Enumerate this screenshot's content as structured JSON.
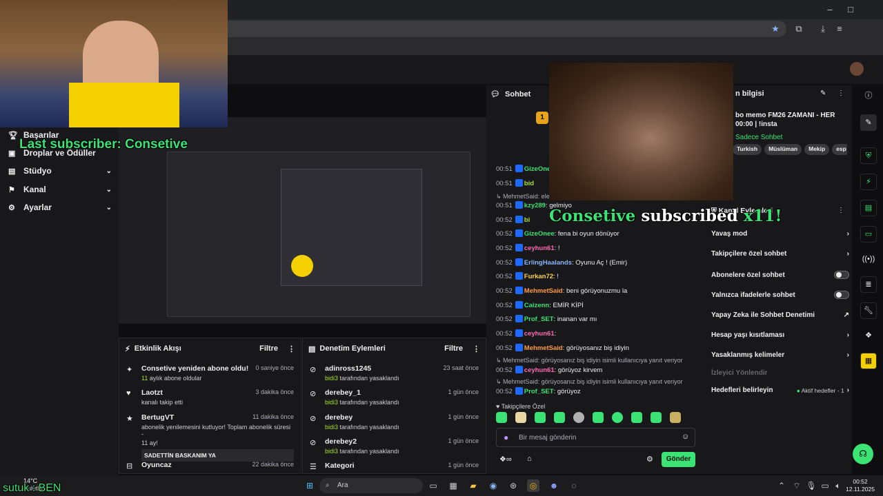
{
  "overlay": {
    "last_subscriber": "Last subscriber: Consetive",
    "sub_alert_name": "Consetive",
    "sub_alert_text": "subscribed",
    "sub_alert_count": "x11!",
    "stream_tag": "sutuk : BEN"
  },
  "leftnav": {
    "items": [
      {
        "label": "Başarılar",
        "icon": "trophy-icon"
      },
      {
        "label": "Droplar ve Ödüller",
        "icon": "gift-icon"
      },
      {
        "label": "Stüdyo",
        "icon": "studio-icon"
      },
      {
        "label": "Kanal",
        "icon": "channel-icon"
      },
      {
        "label": "Ayarlar",
        "icon": "gear-icon"
      }
    ]
  },
  "activity": {
    "title": "Etkinlik Akışı",
    "filter": "Filtre",
    "items": [
      {
        "who": "Consetive yeniden abone oldu!",
        "sub_num": "11",
        "sub": " aylık abone oldular",
        "time": "0 saniye önce"
      },
      {
        "who": "Laotzt",
        "sub": "kanalı takip etti",
        "time": "3 dakika önce"
      },
      {
        "who": "BertugVT",
        "sub": "abonelik yenilemesini kutluyor! Toplam abonelik süresi -",
        "sub2": "11 ay!",
        "time": "11 dakika önce",
        "message": "SADETTİN BASKANIM YA"
      },
      {
        "who": "Oyuncaz",
        "time": "22 dakika önce"
      }
    ]
  },
  "moderation": {
    "title": "Denetim Eylemleri",
    "filter": "Filtre",
    "items": [
      {
        "who": "adinross1245",
        "by": "bidi3",
        "sub": " tarafından yasaklandı",
        "time": "23 saat önce"
      },
      {
        "who": "derebey_1",
        "by": "bidi3",
        "sub": " tarafından yasaklandı",
        "time": "1 gün önce"
      },
      {
        "who": "derebey",
        "by": "bidi3",
        "sub": " tarafından yasaklandı",
        "time": "1 gün önce"
      },
      {
        "who": "derebey2",
        "by": "bidi3",
        "sub": " tarafından yasaklandı",
        "time": "1 gün önce"
      },
      {
        "who": "Kategori",
        "time": "1 gün önce"
      }
    ]
  },
  "chat": {
    "title": "Sohbet",
    "lines": [
      {
        "ts": "00:51",
        "user": "GizeOnee",
        "color": "#3ae374",
        "msg": ""
      },
      {
        "ts": "00:51",
        "user": "bid",
        "color": "#a6e22e",
        "msg": ""
      },
      {
        "reply": "MehmetSaid: elek"
      },
      {
        "ts": "00:51",
        "user": "kzy289",
        "color": "#3ae374",
        "msg": ": gelmiyo"
      },
      {
        "ts": "00:52",
        "user": "bi",
        "color": "#a6e22e",
        "msg": ""
      },
      {
        "ts": "00:52",
        "user": "GizeOnee",
        "color": "#3ae374",
        "msg": ": fena bi oyun dönüyor"
      },
      {
        "ts": "00:52",
        "user": "ceyhun61",
        "color": "#ff69b4",
        "msg": ": !"
      },
      {
        "ts": "00:52",
        "user": "ErlingHaalands",
        "color": "#8ab4f8",
        "msg": ": Oyunu Aç ! (Emir)"
      },
      {
        "ts": "00:52",
        "user": "Furkan72",
        "color": "#ffd23f",
        "msg": ": !"
      },
      {
        "ts": "00:52",
        "user": "MehmetSaid",
        "color": "#ff9a3c",
        "msg": ": beni görüyonuzmu la"
      },
      {
        "ts": "00:52",
        "user": "Caizenn",
        "color": "#3ae374",
        "msg": ": EMİR KİPİ"
      },
      {
        "ts": "00:52",
        "user": "Prof_SET",
        "color": "#3ae374",
        "msg": ": inanan var mı"
      },
      {
        "ts": "00:52",
        "user": "ceyhun61",
        "color": "#ff69b4",
        "msg": ":"
      },
      {
        "ts": "00:52",
        "user": "MehmetSaid",
        "color": "#ff9a3c",
        "msg": ": görüyosanız biş idiyin"
      },
      {
        "reply": "MehmetSaid: görüyosanız biş idiyin isimli kullanıcıya yanıt veriyor"
      },
      {
        "ts": "00:52",
        "user": "ceyhun61",
        "color": "#ff69b4",
        "msg": ": görüyoz kirvem"
      },
      {
        "reply": "MehmetSaid: görüyosanız biş idiyin isimli kullanıcıya yanıt veriyor"
      },
      {
        "ts": "00:52",
        "user": "Prof_SET",
        "color": "#3ae374",
        "msg": ": görüyoz"
      }
    ],
    "followers_only_label": "Takipçilere Özel",
    "input_placeholder": "Bir mesaj gönderin",
    "send_label": "Gönder"
  },
  "stream_info": {
    "title_partial": "n bilgisi",
    "line1": "bo memo FM26 ZAMANI - HER",
    "line2": "00:00 | !insta",
    "subonly": "Sadece Sohbet",
    "tags": [
      "Turkish",
      "Müslüman",
      "Mekip",
      "esp"
    ]
  },
  "channel_actions": {
    "title": "Kanal Eylemleri",
    "rows": [
      {
        "label": "Yavaş mod",
        "type": "chevron"
      },
      {
        "label": "Takipçilere özel sohbet",
        "type": "chevron"
      },
      {
        "label": "Abonelere özel sohbet",
        "type": "toggle"
      },
      {
        "label": "Yalnızca ifadelerle sohbet",
        "type": "toggle"
      },
      {
        "label": "Yapay Zeka ile Sohbet Denetimi",
        "type": "external"
      },
      {
        "label": "Hesap yaşı kısıtlaması",
        "type": "chevron"
      },
      {
        "label": "Yasaklanmış kelimeler",
        "type": "chevron"
      },
      {
        "label": "İzleyici Yönlendir",
        "type": "disabled"
      },
      {
        "label": "Hedefleri belirleyin",
        "type": "status",
        "status": "Aktif hedefler - 1"
      }
    ]
  },
  "taskbar": {
    "weather_temp": "14°C",
    "weather_desc": "Bulutlu",
    "search": "Ara",
    "time": "00:52",
    "date": "12.11.2025"
  },
  "colors": {
    "accent": "#3ae374",
    "bg": "#0e0e10",
    "panel": "#18181b"
  }
}
